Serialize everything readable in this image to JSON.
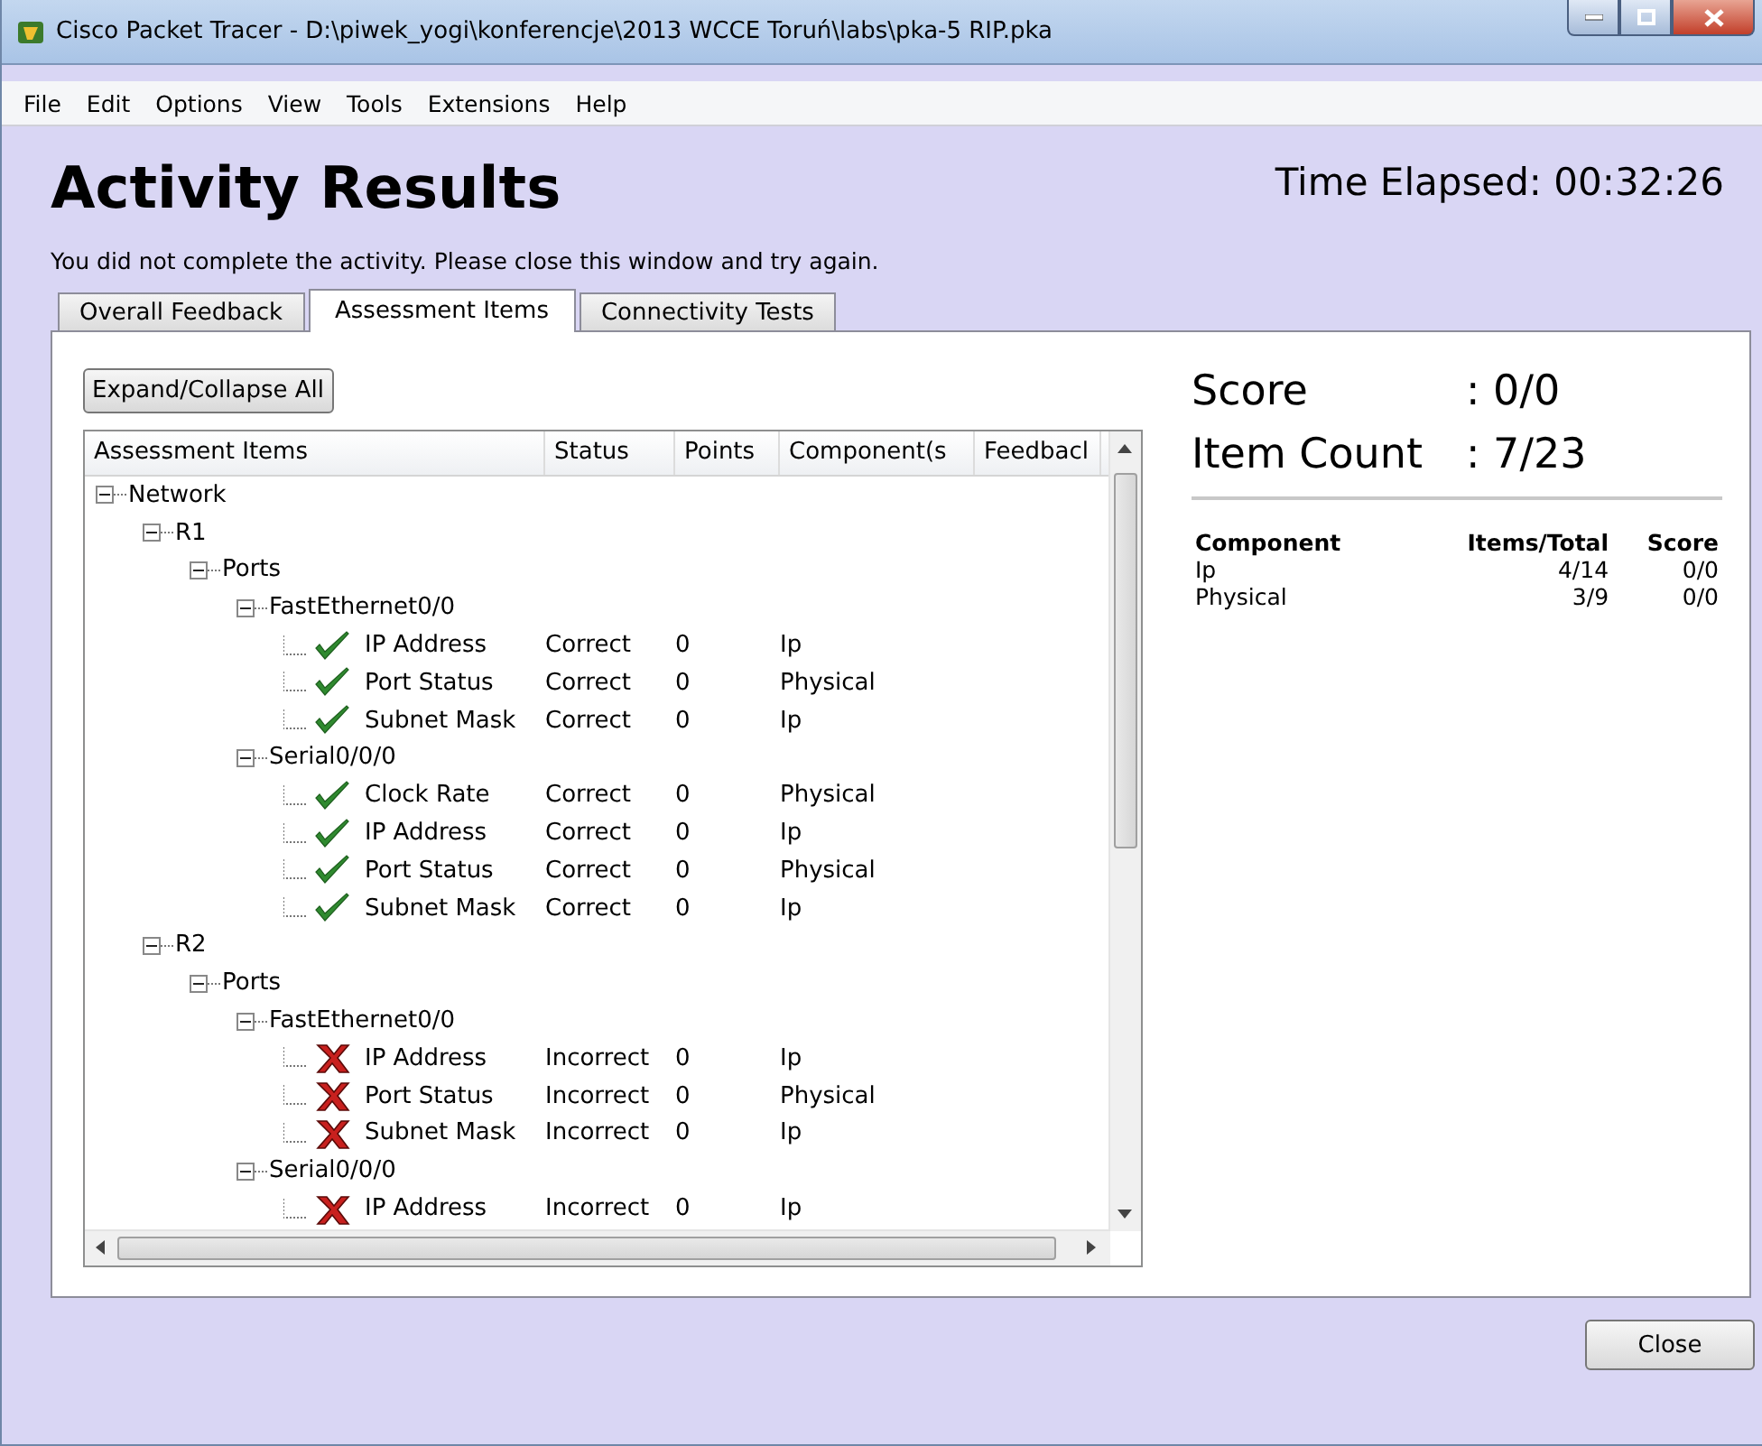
{
  "window": {
    "title": "Cisco Packet Tracer - D:\\piwek_yogi\\konferencje\\2013 WCCE Toruń\\labs\\pka-5 RIP.pka"
  },
  "menu": [
    "File",
    "Edit",
    "Options",
    "View",
    "Tools",
    "Extensions",
    "Help"
  ],
  "heading": "Activity Results",
  "time_elapsed": "Time Elapsed: 00:32:26",
  "message": "You did not complete the activity. Please close this window and try again.",
  "tabs": [
    {
      "label": "Overall Feedback",
      "selected": false
    },
    {
      "label": "Assessment Items",
      "selected": true
    },
    {
      "label": "Connectivity Tests",
      "selected": false
    }
  ],
  "expand_button": "Expand/Collapse All",
  "tree": {
    "columns": [
      "Assessment Items",
      "Status",
      "Points",
      "Component(s",
      "Feedbacl"
    ],
    "rows": [
      {
        "label": "Network",
        "expanded": true,
        "children": [
          {
            "label": "R1",
            "expanded": true,
            "children": [
              {
                "label": "Ports",
                "expanded": true,
                "children": [
                  {
                    "label": "FastEthernet0/0",
                    "expanded": true,
                    "children": [
                      {
                        "label": "IP Address",
                        "status": "Correct",
                        "kind": "correct",
                        "points": "0",
                        "component": "Ip"
                      },
                      {
                        "label": "Port Status",
                        "status": "Correct",
                        "kind": "correct",
                        "points": "0",
                        "component": "Physical"
                      },
                      {
                        "label": "Subnet Mask",
                        "status": "Correct",
                        "kind": "correct",
                        "points": "0",
                        "component": "Ip"
                      }
                    ]
                  },
                  {
                    "label": "Serial0/0/0",
                    "expanded": true,
                    "children": [
                      {
                        "label": "Clock Rate",
                        "status": "Correct",
                        "kind": "correct",
                        "points": "0",
                        "component": "Physical"
                      },
                      {
                        "label": "IP Address",
                        "status": "Correct",
                        "kind": "correct",
                        "points": "0",
                        "component": "Ip"
                      },
                      {
                        "label": "Port Status",
                        "status": "Correct",
                        "kind": "correct",
                        "points": "0",
                        "component": "Physical"
                      },
                      {
                        "label": "Subnet Mask",
                        "status": "Correct",
                        "kind": "correct",
                        "points": "0",
                        "component": "Ip"
                      }
                    ]
                  }
                ]
              }
            ]
          },
          {
            "label": "R2",
            "expanded": true,
            "children": [
              {
                "label": "Ports",
                "expanded": true,
                "children": [
                  {
                    "label": "FastEthernet0/0",
                    "expanded": true,
                    "children": [
                      {
                        "label": "IP Address",
                        "status": "Incorrect",
                        "kind": "incorrect",
                        "points": "0",
                        "component": "Ip"
                      },
                      {
                        "label": "Port Status",
                        "status": "Incorrect",
                        "kind": "incorrect",
                        "points": "0",
                        "component": "Physical"
                      },
                      {
                        "label": "Subnet Mask",
                        "status": "Incorrect",
                        "kind": "incorrect",
                        "points": "0",
                        "component": "Ip"
                      }
                    ]
                  },
                  {
                    "label": "Serial0/0/0",
                    "expanded": true,
                    "children": [
                      {
                        "label": "IP Address",
                        "status": "Incorrect",
                        "kind": "incorrect",
                        "points": "0",
                        "component": "Ip"
                      }
                    ]
                  }
                ]
              }
            ]
          }
        ]
      }
    ]
  },
  "summary": {
    "score_label": "Score",
    "score_value": ": 0/0",
    "count_label": "Item Count",
    "count_value": ": 7/23",
    "columns": [
      "Component",
      "Items/Total",
      "Score"
    ],
    "rows": [
      [
        "Ip",
        "4/14",
        "0/0"
      ],
      [
        "Physical",
        "3/9",
        "0/0"
      ]
    ]
  },
  "close_button": "Close"
}
